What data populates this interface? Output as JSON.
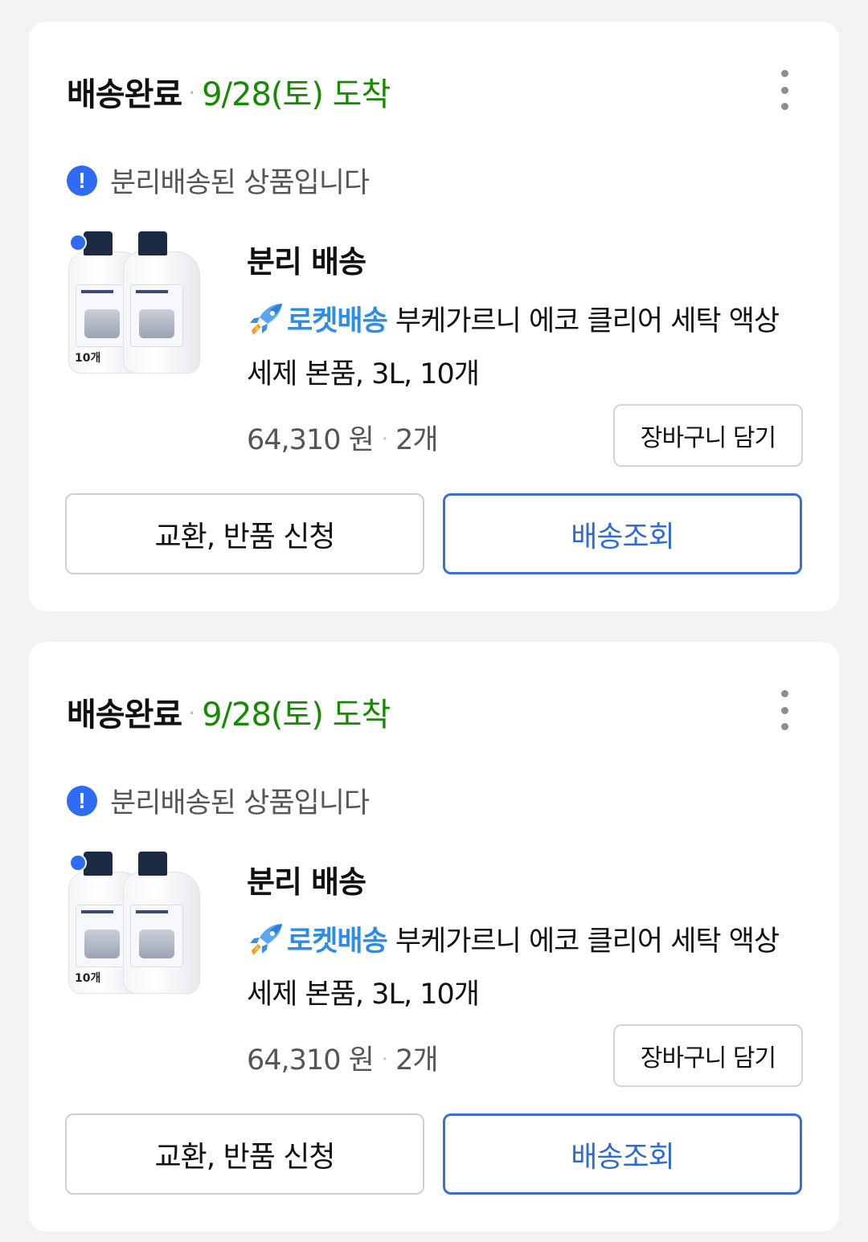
{
  "orders": [
    {
      "status": "배송완료",
      "arrival": "9/28(토) 도착",
      "notice": "분리배송된 상품입니다",
      "subtitle": "분리 배송",
      "rocket_label": "로켓배송",
      "product_name": "부케가르니 에코 클리어 세탁 액상세제 본품, 3L, 10개",
      "quantity_mark": "10개",
      "price": "64,310 원",
      "quantity": "2개",
      "cart_button": "장바구니 담기",
      "return_button": "교환, 반품 신청",
      "track_button": "배송조회"
    },
    {
      "status": "배송완료",
      "arrival": "9/28(토) 도착",
      "notice": "분리배송된 상품입니다",
      "subtitle": "분리 배송",
      "rocket_label": "로켓배송",
      "product_name": "부케가르니 에코 클리어 세탁 액상세제 본품, 3L, 10개",
      "quantity_mark": "10개",
      "price": "64,310 원",
      "quantity": "2개",
      "cart_button": "장바구니 담기",
      "return_button": "교환, 반품 신청",
      "track_button": "배송조회"
    }
  ],
  "colors": {
    "arrival": "#168a00",
    "accent_blue": "#2f6cf6",
    "rocket_text": "#2d8ce8",
    "track_border": "#3a6fcf"
  },
  "icons": {
    "more": "vertical-ellipsis-icon",
    "notice": "exclamation-circle-icon",
    "rocket": "rocket-icon"
  }
}
